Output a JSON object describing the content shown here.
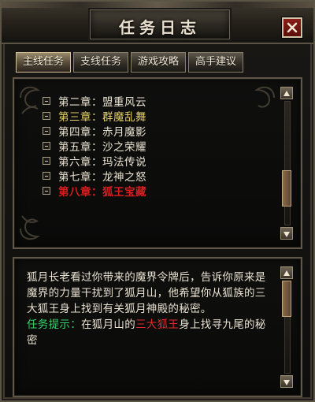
{
  "window": {
    "title": "任务日志"
  },
  "tabs": [
    {
      "label": "主线任务",
      "active": true
    },
    {
      "label": "支线任务",
      "active": false
    },
    {
      "label": "游戏攻略",
      "active": false
    },
    {
      "label": "高手建议",
      "active": false
    }
  ],
  "chapters": [
    {
      "label": "第二章：盟重风云",
      "state": "normal"
    },
    {
      "label": "第三章：群魔乱舞",
      "state": "highlight"
    },
    {
      "label": "第四章：赤月魔影",
      "state": "normal"
    },
    {
      "label": "第五章：沙之荣耀",
      "state": "normal"
    },
    {
      "label": "第六章：玛法传说",
      "state": "normal"
    },
    {
      "label": "第七章：龙神之怒",
      "state": "normal"
    },
    {
      "label": "第八章：狐王宝藏",
      "state": "current"
    }
  ],
  "description": {
    "body": "狐月长老看过你带来的魔界令牌后，告诉你原来是魔界的力量干扰到了狐月山，他希望你从狐族的三大狐王身上找到有关狐月神殿的秘密。",
    "hint_label": "任务提示：",
    "hint_before": "在狐月山的",
    "hint_highlight": "三大狐王",
    "hint_after": "身上找寻九尾的秘密"
  },
  "colors": {
    "normal": "#e9e2d1",
    "highlight": "#e6d16a",
    "current": "#d81e1e",
    "hint_label": "#38d26a"
  },
  "scroll": {
    "chapters_position": 0.78,
    "description_position": 0.02
  }
}
